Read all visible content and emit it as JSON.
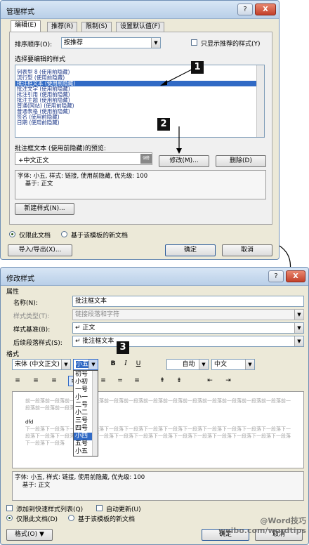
{
  "dialog1": {
    "title": "管理样式",
    "help": "?",
    "close": "X",
    "tabs": [
      "编辑(E)",
      "推荐(R)",
      "限制(S)",
      "设置默认值(F)"
    ],
    "sort_label": "排序顺序(O):",
    "sort_value": "按推荐",
    "only_recommended": "只显示推荐的样式(Y)",
    "select_label": "选择要编辑的样式",
    "styles": [
      "列表型 8 (使用前隐藏)",
      "流行型 (使用前隐藏)",
      "批注框文本 (使用前隐藏)",
      "批注文字 (使用前隐藏)",
      "批注引用 (使用前隐藏)",
      "批注主题 (使用前隐藏)",
      "普通(网站) (使用前隐藏)",
      "普通表格 (使用前隐藏)",
      "签名 (使用前隐藏)",
      "日期 (使用前隐藏)"
    ],
    "preview_label": "批注框文本 (使用前隐藏)的预览:",
    "preview_text": "+中文正文",
    "preview_size": "9磅",
    "modify_button": "修改(M)...",
    "delete_button": "删除(D)",
    "description": "字体: 小五, 样式: 链接, 使用前隐藏, 优先级: 100\n    基于: 正文",
    "new_style_button": "新建样式(N)...",
    "only_this_doc": "仅限此文档",
    "template_docs": "基于该模板的新文档",
    "import_export": "导入/导出(X)...",
    "ok": "确定",
    "cancel": "取消"
  },
  "dialog2": {
    "title": "修改样式",
    "help": "?",
    "close": "X",
    "props_section": "属性",
    "name_label": "名称(N):",
    "name_value": "批注框文本",
    "type_label": "样式类型(T):",
    "type_value": "链接段落和字符",
    "base_label": "样式基准(B):",
    "base_value": "↵ 正文",
    "next_label": "后续段落样式(S):",
    "next_value": "↵ 批注框文本",
    "format_section": "格式",
    "font_value": "宋体 (中文正文)",
    "size_value": "小五",
    "bold": "B",
    "italic": "I",
    "underline": "U",
    "color_value": "自动",
    "lang_value": "中文",
    "size_options": [
      "初号",
      "小初",
      "一号",
      "小一",
      "二号",
      "小二",
      "三号",
      "四号",
      "小四",
      "五号",
      "小五"
    ],
    "size_selected_index": 8,
    "preview_before": "前一段落前一段落前一段落前一段落前一段落前一段落前一段落前一段落前一段落前一段落前一段落前一段落前一段落前一段落前一段落前一段落前一段落",
    "preview_sample": "dfd",
    "preview_after": "下一段落下一段落下一段落下一段落下一段落下一段落下一段落下一段落下一段落下一段落下一段落下一段落下一段落下一段落下一段落下一段落下一段落下一段落下一段落下一段落下一段落下一段落下一段落下一段落下一段落下一段落下一段落下一段落下一段落",
    "description": "字体: 小五, 样式: 链接, 使用前隐藏, 优先级: 100\n    基于: 正文",
    "add_quick": "添加到快速样式列表(Q)",
    "auto_update": "自动更新(U)",
    "only_this_doc": "仅限此文档(D)",
    "template_docs": "基于该模板的新文档",
    "format_button": "格式(O) ▼",
    "ok": "确定",
    "cancel": "取消"
  },
  "badges": [
    "1",
    "2",
    "3"
  ],
  "watermark": "@Word技巧 weibo.com/wordtips"
}
